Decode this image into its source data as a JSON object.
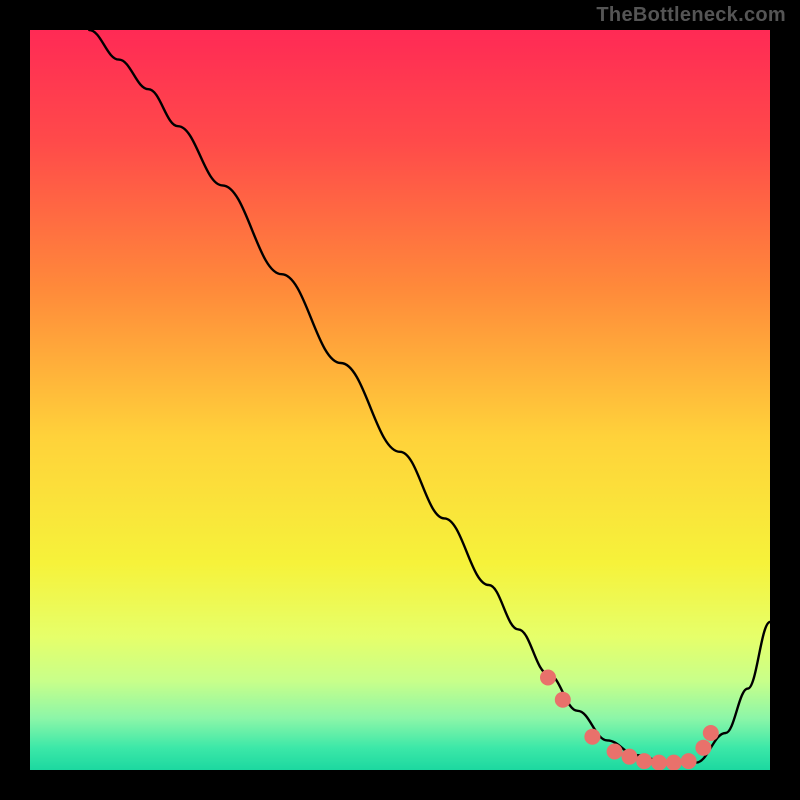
{
  "watermark": "TheBottleneck.com",
  "chart_data": {
    "type": "line",
    "title": "",
    "xlabel": "",
    "ylabel": "",
    "xlim": [
      0,
      100
    ],
    "ylim": [
      0,
      100
    ],
    "gradient_stops": [
      {
        "offset": 0.0,
        "color": "#FF2A55"
      },
      {
        "offset": 0.15,
        "color": "#FF4A4A"
      },
      {
        "offset": 0.35,
        "color": "#FF8A3A"
      },
      {
        "offset": 0.55,
        "color": "#FFD23A"
      },
      {
        "offset": 0.72,
        "color": "#F6F23A"
      },
      {
        "offset": 0.82,
        "color": "#E6FF6A"
      },
      {
        "offset": 0.88,
        "color": "#C8FF8A"
      },
      {
        "offset": 0.93,
        "color": "#8CF6A8"
      },
      {
        "offset": 0.97,
        "color": "#3CE8A8"
      },
      {
        "offset": 1.0,
        "color": "#1CD8A0"
      }
    ],
    "curve": {
      "x": [
        8,
        12,
        16,
        20,
        26,
        34,
        42,
        50,
        56,
        62,
        66,
        70,
        74,
        78,
        82,
        86,
        90,
        94,
        97,
        100
      ],
      "y": [
        100,
        96,
        92,
        87,
        79,
        67,
        55,
        43,
        34,
        25,
        19,
        13,
        8,
        4,
        2,
        1,
        1,
        5,
        11,
        20
      ]
    },
    "markers": {
      "x": [
        70,
        72,
        76,
        79,
        81,
        83,
        85,
        87,
        89,
        91,
        92
      ],
      "y": [
        12.5,
        9.5,
        4.5,
        2.5,
        1.8,
        1.2,
        1.0,
        1.0,
        1.2,
        3.0,
        5.0
      ],
      "color": "#E9716B",
      "radius": 8
    }
  }
}
